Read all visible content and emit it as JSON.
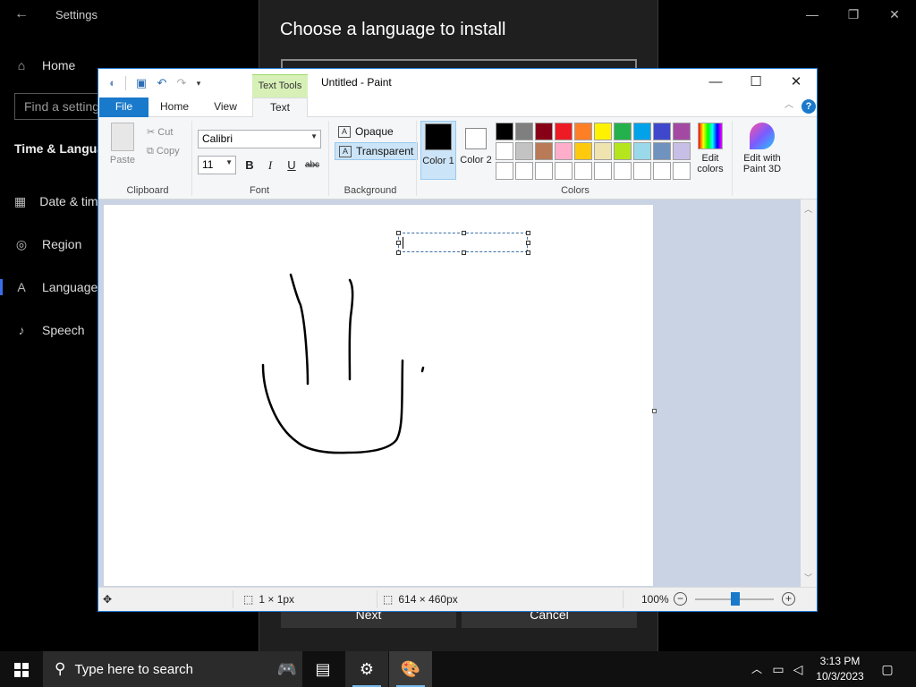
{
  "settings": {
    "title": "Settings",
    "search_placeholder": "Find a setting",
    "section": "Time & Language",
    "nav": [
      {
        "label": "Home",
        "icon": "home-icon"
      },
      {
        "label": "Date & time",
        "icon": "calendar-icon"
      },
      {
        "label": "Region",
        "icon": "globe-icon"
      },
      {
        "label": "Language",
        "icon": "language-icon"
      },
      {
        "label": "Speech",
        "icon": "microphone-icon"
      }
    ]
  },
  "language_dialog": {
    "title": "Choose a language to install",
    "next_label": "Next",
    "cancel_label": "Cancel"
  },
  "paint": {
    "window_title": "Untitled - Paint",
    "context_tab": "Text Tools",
    "tabs": [
      "File",
      "Home",
      "View",
      "Text"
    ],
    "active_tab": "Text",
    "clipboard": {
      "paste": "Paste",
      "cut": "Cut",
      "copy": "Copy",
      "group": "Clipboard"
    },
    "font": {
      "family": "Calibri",
      "size": "11",
      "group": "Font",
      "bold": "B",
      "italic": "I",
      "underline": "U",
      "strike": "abc"
    },
    "background": {
      "opaque": "Opaque",
      "transparent": "Transparent",
      "group": "Background",
      "selected": "Transparent"
    },
    "colors": {
      "color1_label": "Color 1",
      "color2_label": "Color 2",
      "color1": "#000000",
      "color2": "#ffffff",
      "edit_colors": "Edit colors",
      "edit_paint3d": "Edit with Paint 3D",
      "group": "Colors",
      "palette": [
        "#000000",
        "#7f7f7f",
        "#880015",
        "#ed1c24",
        "#ff7f27",
        "#fff200",
        "#22b14c",
        "#00a2e8",
        "#3f48cc",
        "#a349a4",
        "#ffffff",
        "#c3c3c3",
        "#b97a57",
        "#ffaec9",
        "#ffc90e",
        "#efe4b0",
        "#b5e61d",
        "#99d9ea",
        "#7092be",
        "#c8bfe7",
        "#ffffff",
        "#ffffff",
        "#ffffff",
        "#ffffff",
        "#ffffff",
        "#ffffff",
        "#ffffff",
        "#ffffff",
        "#ffffff",
        "#ffffff"
      ]
    },
    "status": {
      "selection_size": "1 × 1px",
      "canvas_size": "614 × 460px",
      "zoom": "100%"
    }
  },
  "taskbar": {
    "search_placeholder": "Type here to search",
    "time": "3:13 PM",
    "date": "10/3/2023"
  }
}
